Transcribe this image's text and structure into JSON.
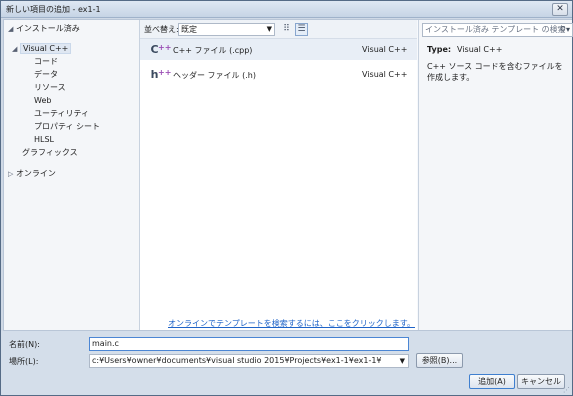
{
  "window": {
    "title": "新しい項目の追加 - ex1-1",
    "close_label": "✕"
  },
  "left_panel": {
    "header": "インストール済み",
    "items": [
      {
        "label": "Visual C++"
      },
      {
        "label": "コード"
      },
      {
        "label": "データ"
      },
      {
        "label": "リソース"
      },
      {
        "label": "Web"
      },
      {
        "label": "ユーティリティ"
      },
      {
        "label": "プロパティ シート"
      },
      {
        "label": "HLSL"
      },
      {
        "label": "グラフィックス"
      }
    ],
    "online": "オンライン"
  },
  "toolbar": {
    "sort_label": "並べ替え:",
    "sort_value": "既定",
    "view_small_icon": "grid-view-icon",
    "view_list_icon": "list-view-icon"
  },
  "templates": [
    {
      "icon": "cpp-file-icon",
      "glyph": "C",
      "name": "C++ ファイル (.cpp)",
      "lang": "Visual C++"
    },
    {
      "icon": "header-file-icon",
      "glyph": "h",
      "name": "ヘッダー ファイル (.h)",
      "lang": "Visual C++"
    }
  ],
  "online_link": "オンラインでテンプレートを検索するには、ここをクリックします。",
  "search": {
    "placeholder": "インストール済み テンプレート の検索"
  },
  "details": {
    "type_label": "Type:",
    "type_value": "Visual C++",
    "description": "C++ ソース コードを含むファイルを作成します。"
  },
  "form": {
    "name_label": "名前(N):",
    "name_value": "main.c",
    "location_label": "場所(L):",
    "location_value": "c:¥Users¥owner¥documents¥visual studio 2015¥Projects¥ex1-1¥ex1-1¥",
    "browse_label": "参照(B)...",
    "add_label": "追加(A)",
    "cancel_label": "キャンセル"
  },
  "colors": {
    "link": "#1e63c8",
    "accent_border": "#4b86d4"
  }
}
